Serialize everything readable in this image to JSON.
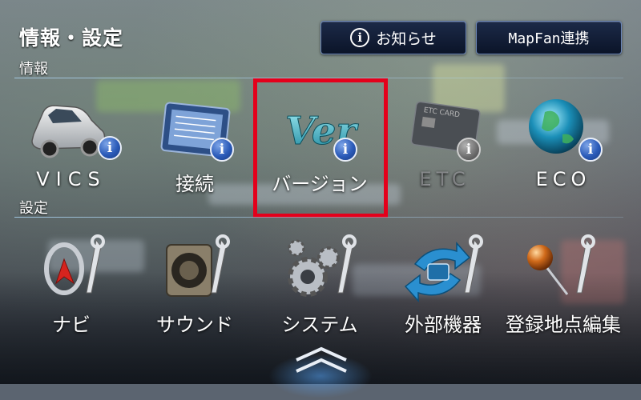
{
  "header": {
    "title": "情報・設定",
    "info_button_label": "お知らせ",
    "mapfan_button_label": "MapFan連携"
  },
  "sections": {
    "info_label": "情報",
    "settings_label": "設定"
  },
  "info_items": [
    {
      "label": "VICS",
      "icon": "car-icon",
      "badge": "i",
      "enabled": true
    },
    {
      "label": "接続",
      "icon": "device-panel-icon",
      "badge": "i",
      "enabled": true
    },
    {
      "label": "バージョン",
      "icon": "ver-icon",
      "badge": "i",
      "enabled": true,
      "highlighted": true
    },
    {
      "label": "ETC",
      "icon": "etc-card-icon",
      "badge": "i",
      "enabled": false
    },
    {
      "label": "ECO",
      "icon": "globe-icon",
      "badge": "i",
      "enabled": true
    }
  ],
  "settings_items": [
    {
      "label": "ナビ",
      "icon": "compass-wrench-icon"
    },
    {
      "label": "サウンド",
      "icon": "speaker-wrench-icon"
    },
    {
      "label": "システム",
      "icon": "gears-wrench-icon"
    },
    {
      "label": "外部機器",
      "icon": "sync-wrench-icon"
    },
    {
      "label": "登録地点編集",
      "icon": "pin-wrench-icon"
    }
  ],
  "icon_text": {
    "ver": "Ver",
    "etc_card": "ETC CARD"
  },
  "colors": {
    "highlight": "#e4001b",
    "button_bg": "#0b1428",
    "badge_blue": "#2b5bb9"
  }
}
